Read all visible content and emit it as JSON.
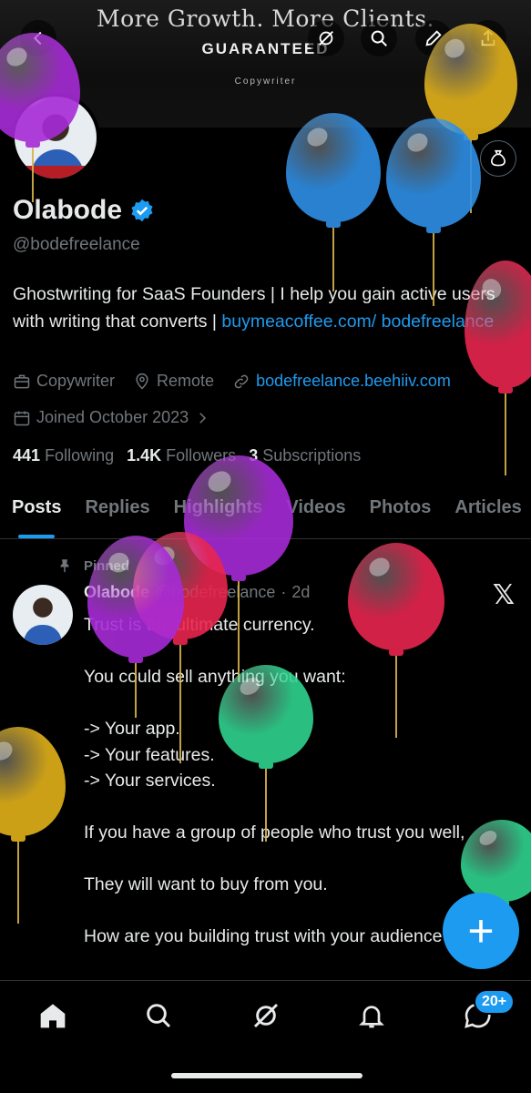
{
  "banner": {
    "headline": "More Growth. More Clients.",
    "subline": "GUARANTEED",
    "tagline": "Copywriter"
  },
  "profile": {
    "name": "Olabode",
    "handle": "@bodefreelance",
    "bio_text": "Ghostwriting for SaaS Founders | I help you gain active users with writing that converts | ",
    "bio_link": "buymeacoffee.com/ bodefreelance",
    "category": "Copywriter",
    "location": "Remote",
    "website": "bodefreelance.beehiiv.com",
    "joined": "Joined October 2023",
    "following_count": "441",
    "following_label": "Following",
    "followers_count": "1.4K",
    "followers_label": "Followers",
    "subscriptions_count": "3",
    "subscriptions_label": "Subscriptions"
  },
  "tabs": [
    "Posts",
    "Replies",
    "Highlights",
    "Videos",
    "Photos",
    "Articles"
  ],
  "post": {
    "pinned_label": "Pinned",
    "author_name": "Olabode",
    "author_handle": "@bodefreelance",
    "time": "2d",
    "body": "Trust is the ultimate currency.\n\nYou could sell anything you want:\n\n-> Your app.\n-> Your features.\n-> Your services.\n\nIf you have a group of people who trust you well,\n\nThey will want to buy from you.\n\nHow are you building trust with your audience"
  },
  "fab_label": "+",
  "nav": {
    "messages_badge": "20+"
  },
  "colors": {
    "accent": "#1d9bf0",
    "background": "#000000",
    "muted": "#71767b",
    "balloon_purple": "#a72bd6",
    "balloon_blue": "#2e8fe6",
    "balloon_yellow": "#e2b21a",
    "balloon_red": "#e8254f",
    "balloon_green": "#2fd48f"
  },
  "icons": [
    "back-arrow-icon",
    "grok-icon",
    "search-icon",
    "edit-icon",
    "share-icon",
    "money-bag-icon",
    "verified-badge-icon",
    "briefcase-icon",
    "location-pin-icon",
    "link-icon",
    "calendar-icon",
    "chevron-right-icon",
    "pin-icon",
    "x-logo-icon",
    "home-icon",
    "explore-icon",
    "grok-nav-icon",
    "notifications-icon",
    "messages-icon"
  ]
}
